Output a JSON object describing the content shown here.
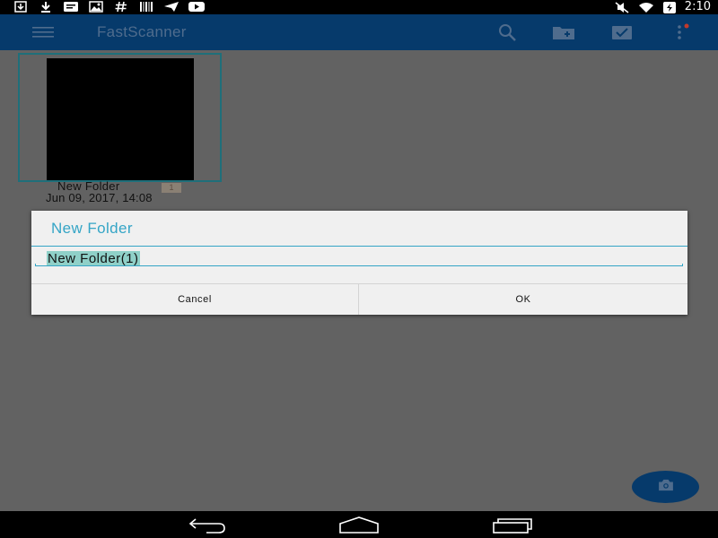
{
  "status_bar": {
    "time": "2:10",
    "left_icons": [
      "download-box-icon",
      "download-icon",
      "message-icon",
      "photo-icon",
      "hash-icon",
      "barcode-icon",
      "send-icon",
      "youtube-icon"
    ],
    "right_icons": [
      "mute-icon",
      "wifi-icon",
      "battery-icon"
    ]
  },
  "app_bar": {
    "title": "FastScanner",
    "actions": [
      "search-icon",
      "new-folder-icon",
      "select-icon",
      "overflow-menu-icon"
    ]
  },
  "folder": {
    "name": "New Folder",
    "count": "1",
    "date": "Jun 09, 2017, 14:08"
  },
  "dialog": {
    "title": "New Folder",
    "input_value": "New Folder(1)",
    "cancel_label": "Cancel",
    "ok_label": "OK"
  },
  "fab": {
    "icon": "camera-icon"
  },
  "nav_bar": {
    "buttons": [
      "back-icon",
      "home-icon",
      "recents-icon"
    ]
  },
  "colors": {
    "app_bar": "#063a6b",
    "accent": "#35a5c6",
    "selection": "#8fd0c8",
    "content_bg": "#626262"
  }
}
